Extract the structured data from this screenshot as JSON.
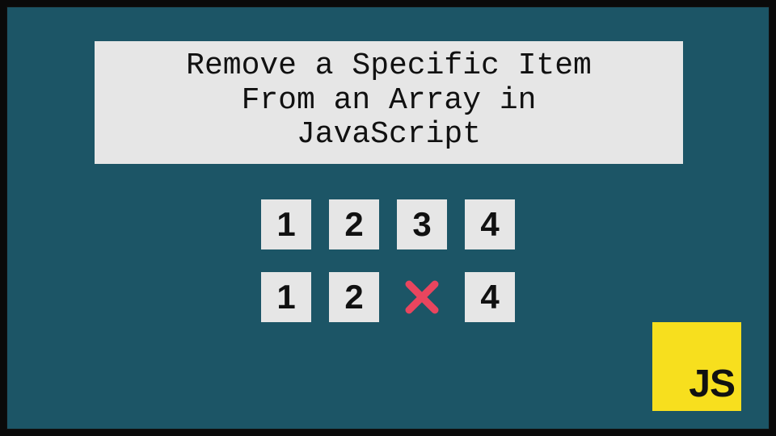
{
  "title": "Remove a Specific Item\nFrom an Array in\nJavaScript",
  "rows": {
    "before": [
      "1",
      "2",
      "3",
      "4"
    ],
    "after": [
      "1",
      "2",
      null,
      "4"
    ]
  },
  "removed_icon": "x-icon",
  "badge": {
    "label": "JS",
    "bg": "#f7df1e"
  },
  "colors": {
    "canvas_bg": "#1c5566",
    "cell_bg": "#e6e6e6",
    "x_color": "#e9455e"
  }
}
